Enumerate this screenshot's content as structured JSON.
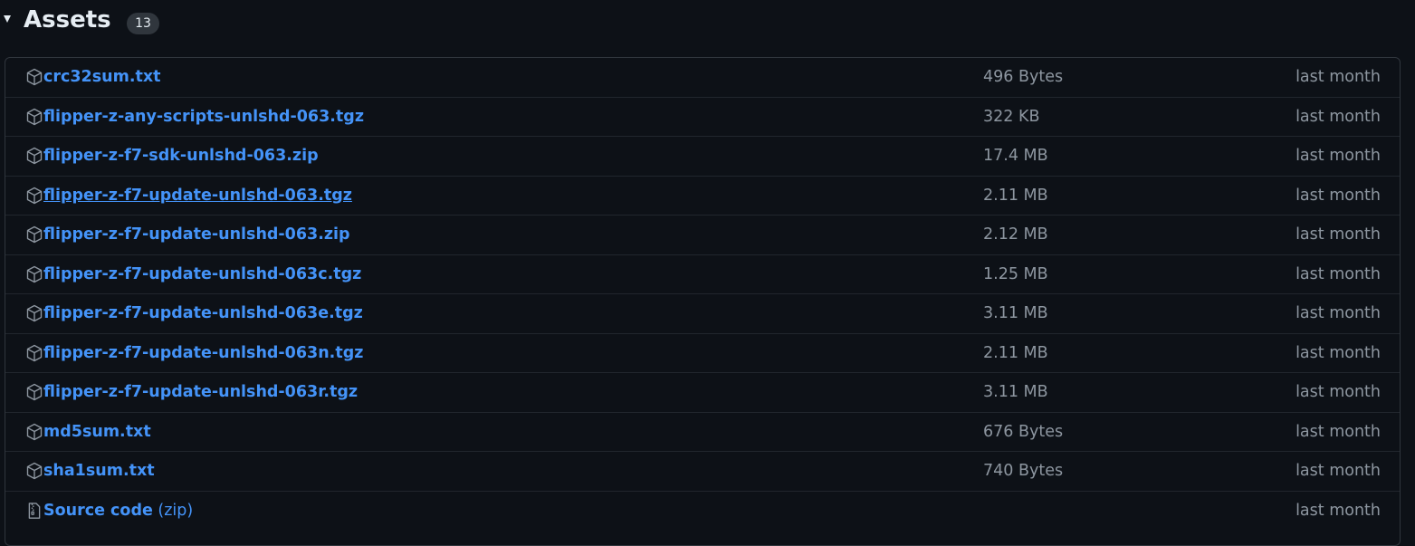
{
  "assets": {
    "title": "Assets",
    "count": "13",
    "accent_color": "#4493f8",
    "items": [
      {
        "name": "crc32sum.txt",
        "suffix": "",
        "size": "496 Bytes",
        "time": "last month",
        "icon": "package-icon"
      },
      {
        "name": "flipper-z-any-scripts-unlshd-063.tgz",
        "suffix": "",
        "size": "322 KB",
        "time": "last month",
        "icon": "package-icon"
      },
      {
        "name": "flipper-z-f7-sdk-unlshd-063.zip",
        "suffix": "",
        "size": "17.4 MB",
        "time": "last month",
        "icon": "package-icon"
      },
      {
        "name": "flipper-z-f7-update-unlshd-063.tgz",
        "suffix": "",
        "size": "2.11 MB",
        "time": "last month",
        "icon": "package-icon",
        "hovered": true
      },
      {
        "name": "flipper-z-f7-update-unlshd-063.zip",
        "suffix": "",
        "size": "2.12 MB",
        "time": "last month",
        "icon": "package-icon"
      },
      {
        "name": "flipper-z-f7-update-unlshd-063c.tgz",
        "suffix": "",
        "size": "1.25 MB",
        "time": "last month",
        "icon": "package-icon"
      },
      {
        "name": "flipper-z-f7-update-unlshd-063e.tgz",
        "suffix": "",
        "size": "3.11 MB",
        "time": "last month",
        "icon": "package-icon"
      },
      {
        "name": "flipper-z-f7-update-unlshd-063n.tgz",
        "suffix": "",
        "size": "2.11 MB",
        "time": "last month",
        "icon": "package-icon"
      },
      {
        "name": "flipper-z-f7-update-unlshd-063r.tgz",
        "suffix": "",
        "size": "3.11 MB",
        "time": "last month",
        "icon": "package-icon"
      },
      {
        "name": "md5sum.txt",
        "suffix": "",
        "size": "676 Bytes",
        "time": "last month",
        "icon": "package-icon"
      },
      {
        "name": "sha1sum.txt",
        "suffix": "",
        "size": "740 Bytes",
        "time": "last month",
        "icon": "package-icon"
      },
      {
        "name": "Source code",
        "suffix": " (zip)",
        "size": "",
        "time": "last month",
        "icon": "file-zip-icon"
      }
    ]
  }
}
